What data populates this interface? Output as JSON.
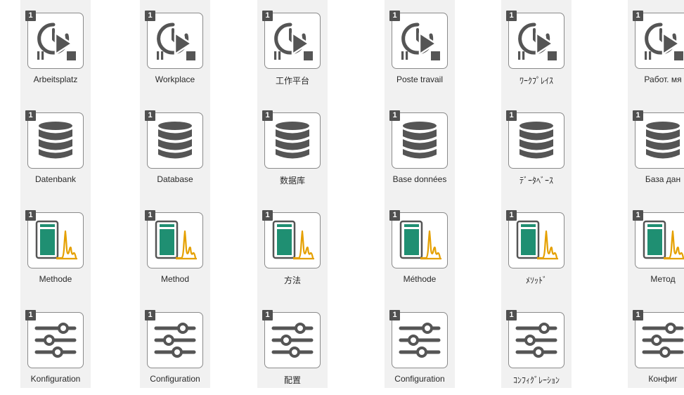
{
  "badge_count": "1",
  "colors": {
    "icon_gray": "#555555",
    "method_green": "#1f8f72",
    "method_peak": "#e5a000",
    "column_bg": "#f1f1f1"
  },
  "icons": {
    "workplace": "workplace-run-icon",
    "database": "database-icon",
    "method": "method-chromatogram-icon",
    "configuration": "configuration-sliders-icon"
  },
  "columns": [
    {
      "language": "de",
      "workplace": "Arbeitsplatz",
      "database": "Datenbank",
      "method": "Methode",
      "configuration": "Konfiguration"
    },
    {
      "language": "en",
      "workplace": "Workplace",
      "database": "Database",
      "method": "Method",
      "configuration": "Configuration"
    },
    {
      "language": "zh",
      "workplace": "工作平台",
      "database": "数据库",
      "method": "方法",
      "configuration": "配置"
    },
    {
      "language": "fr",
      "workplace": "Poste travail",
      "database": "Base données",
      "method": "Méthode",
      "configuration": "Configuration"
    },
    {
      "language": "ja",
      "workplace": "ﾜｰｸﾌﾟﾚｲｽ",
      "database": "ﾃﾞｰﾀﾍﾞｰｽ",
      "method": "ﾒｿｯﾄﾞ",
      "configuration": "ｺﾝﾌｨｸﾞﾚｰｼｮﾝ"
    },
    {
      "language": "ru",
      "workplace": "Работ. мя",
      "database": "База дан",
      "method": "Метод",
      "configuration": "Конфиг"
    }
  ]
}
